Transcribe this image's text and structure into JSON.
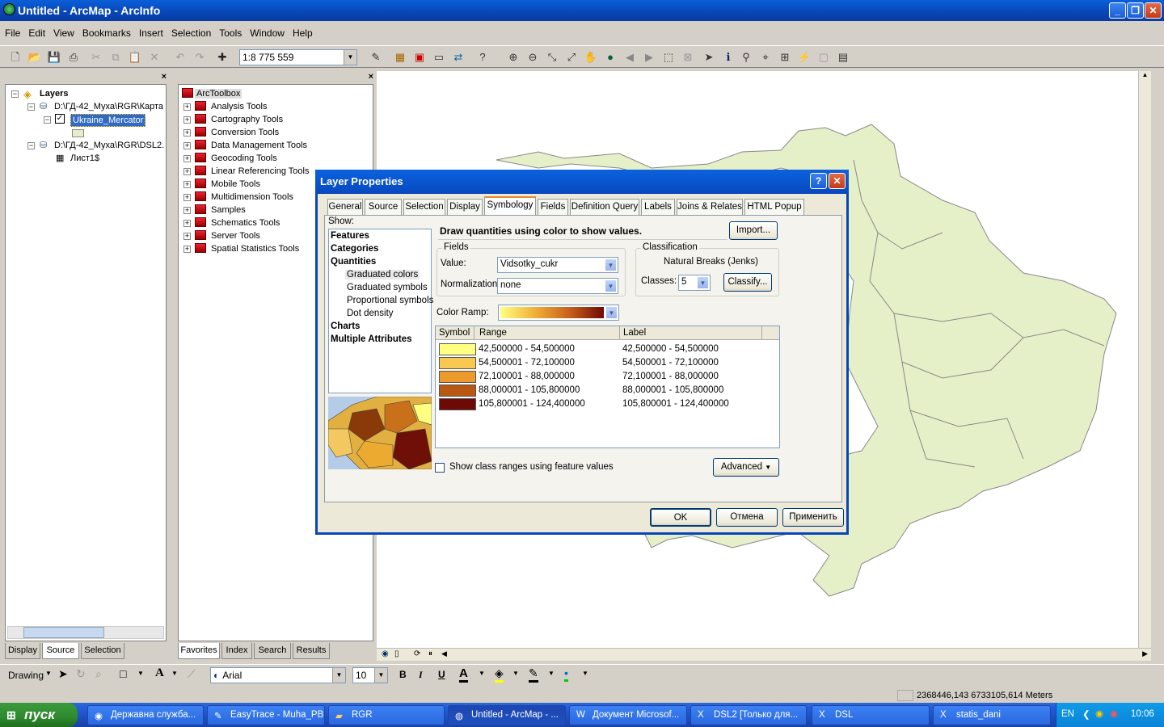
{
  "window": {
    "title": "Untitled - ArcMap - ArcInfo"
  },
  "menu": [
    "File",
    "Edit",
    "View",
    "Bookmarks",
    "Insert",
    "Selection",
    "Tools",
    "Window",
    "Help"
  ],
  "toolbar": {
    "scale": "1:8 775 559"
  },
  "toc": {
    "root": "Layers",
    "items": [
      "D:\\ГД-42_Муха\\RGR\\Карта",
      "Ukraine_Mercator",
      "D:\\ГД-42_Муха\\RGR\\DSL2.",
      "Лист1$"
    ],
    "tabs": [
      "Display",
      "Source",
      "Selection"
    ]
  },
  "toolbox": {
    "root": "ArcToolbox",
    "items": [
      "Analysis Tools",
      "Cartography Tools",
      "Conversion Tools",
      "Data Management Tools",
      "Geocoding Tools",
      "Linear Referencing Tools",
      "Mobile Tools",
      "Multidimension Tools",
      "Samples",
      "Schematics Tools",
      "Server Tools",
      "Spatial Statistics Tools"
    ],
    "tabs": [
      "Favorites",
      "Index",
      "Search",
      "Results"
    ]
  },
  "dialog": {
    "title": "Layer Properties",
    "tabs": [
      "General",
      "Source",
      "Selection",
      "Display",
      "Symbology",
      "Fields",
      "Definition Query",
      "Labels",
      "Joins & Relates",
      "HTML Popup"
    ],
    "show_label": "Show:",
    "show_items": [
      "Features",
      "Categories",
      "Quantities",
      "Graduated colors",
      "Graduated symbols",
      "Proportional symbols",
      "Dot density",
      "Charts",
      "Multiple Attributes"
    ],
    "heading": "Draw quantities using color to show values.",
    "import": "Import...",
    "fields_label": "Fields",
    "value_label": "Value:",
    "value": "Vidsotky_cukr",
    "norm_label": "Normalization:",
    "norm": "none",
    "class_label": "Classification",
    "method": "Natural Breaks (Jenks)",
    "classes_label": "Classes:",
    "classes": "5",
    "classify": "Classify...",
    "ramp_label": "Color Ramp:",
    "cols": [
      "Symbol",
      "Range",
      "Label"
    ],
    "rows": [
      {
        "color": "#ffff80",
        "range": "42,500000 - 54,500000",
        "label": "42,500000 - 54,500000"
      },
      {
        "color": "#f8c850",
        "range": "54,500001 - 72,100000",
        "label": "54,500001 - 72,100000"
      },
      {
        "color": "#ec9a2c",
        "range": "72,100001 - 88,000000",
        "label": "72,100001 - 88,000000"
      },
      {
        "color": "#b85812",
        "range": "88,000001 - 105,800000",
        "label": "88,000001 - 105,800000"
      },
      {
        "color": "#6e0a06",
        "range": "105,800001 - 124,400000",
        "label": "105,800001 - 124,400000"
      }
    ],
    "show_ranges": "Show class ranges using feature values",
    "advanced": "Advanced",
    "ok": "OK",
    "cancel": "Отмена",
    "apply": "Применить"
  },
  "drawing": {
    "label": "Drawing",
    "font": "Arial",
    "size": "10"
  },
  "status": {
    "coords": "2368446,143  6733105,614 Meters"
  },
  "taskbar": {
    "start": "пуск",
    "tasks": [
      "Державна служба...",
      "EasyTrace - Muha_PB",
      "RGR",
      "Untitled - ArcMap - ...",
      "Документ Microsof...",
      "DSL2  [Только для...",
      "DSL",
      "statis_dani"
    ],
    "lang": "EN",
    "time": "10:06"
  }
}
